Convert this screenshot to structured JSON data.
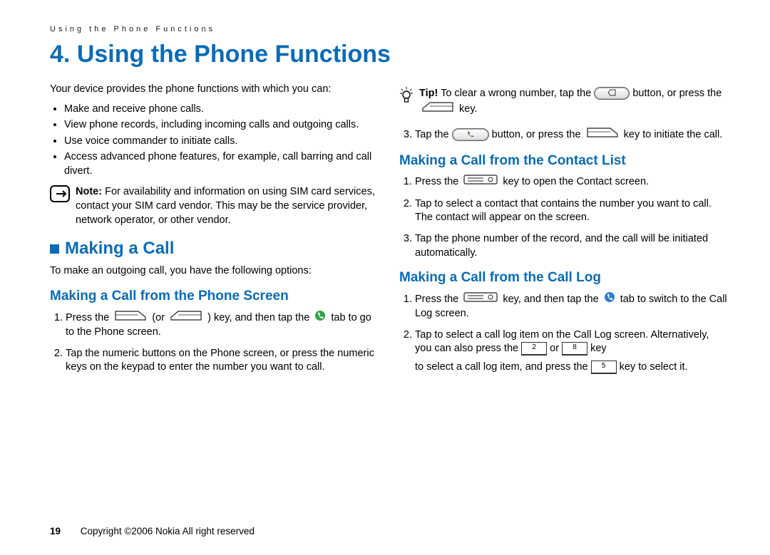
{
  "running_head": "Using the Phone Functions",
  "chapter_number": "4.",
  "chapter_title": "Using the Phone Functions",
  "intro": "Your device provides the phone functions with which you can:",
  "bullets": [
    "Make and receive phone calls.",
    "View phone records, including incoming calls and outgoing calls.",
    "Use voice commander to initiate calls.",
    "Access advanced phone features, for example, call barring and call divert."
  ],
  "note_label": "Note:",
  "note_text": " For availability and information on using SIM card services, contact your SIM card vendor. This may be the service provider, network operator, or other vendor.",
  "h2_making_call": "Making a Call",
  "making_call_intro": "To make an outgoing call, you have the following options:",
  "h3_phone_screen": "Making a Call from the Phone Screen",
  "ps_step1_a": "Press the ",
  "ps_step1_b": " (or ",
  "ps_step1_c": ") key, and then tap the ",
  "ps_step1_d": " tab to go to the Phone screen.",
  "ps_step2": "Tap the numeric buttons on the Phone screen, or press the numeric keys on the keypad to enter the number you want to call.",
  "tip_label": "Tip!",
  "tip_a": " To clear a wrong number, tap the ",
  "tip_b": " button, or press the ",
  "tip_c": " key.",
  "ps_step3_a": "Tap the ",
  "ps_step3_b": " button, or press the ",
  "ps_step3_c": " key to initiate the call.",
  "h3_contact_list": "Making a Call from the Contact List",
  "cl_step1_a": "Press the ",
  "cl_step1_b": " key to open the Contact screen.",
  "cl_step2": "Tap to select a contact that contains the number you want to call. The contact will appear on the screen.",
  "cl_step3": "Tap the phone number of the record, and the call will be initiated automatically.",
  "h3_call_log": "Making a Call from the Call Log",
  "log_step1_a": "Press the ",
  "log_step1_b": " key, and then tap the ",
  "log_step1_c": " tab to switch to the Call Log screen.",
  "log_step2_a": "Tap to select a call log item on the Call Log screen. Alternatively, you can also press the ",
  "log_step2_b": " or ",
  "log_step2_c": " key",
  "log_step2_d": "to select a call log item, and press the ",
  "log_step2_e": " key to select it.",
  "key2": "2",
  "key8": "8",
  "key5": "5",
  "page_number": "19",
  "copyright": "Copyright ©2006 Nokia All right reserved"
}
